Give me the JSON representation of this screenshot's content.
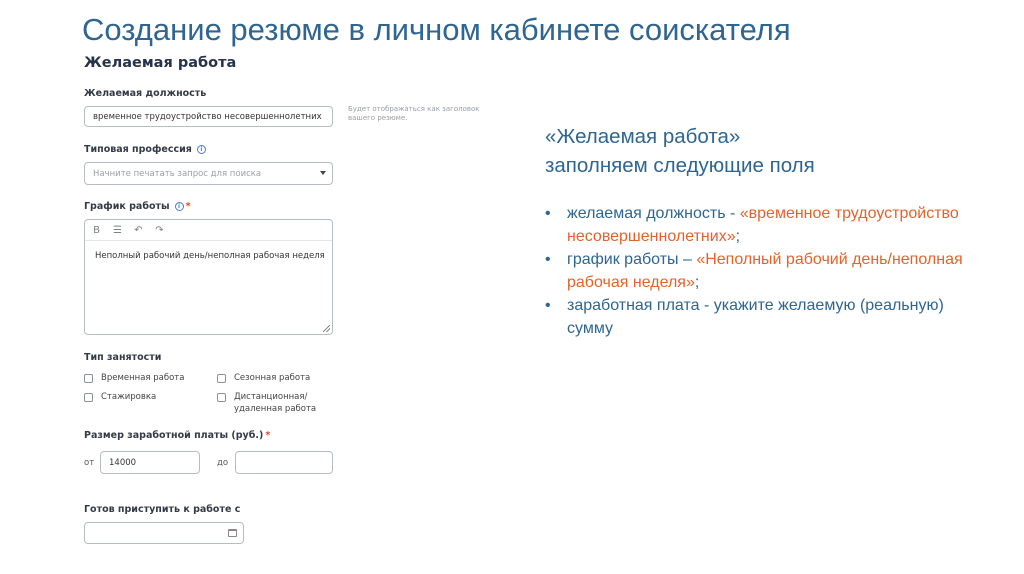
{
  "slide": {
    "title": "Создание резюме в личном кабинете соискателя"
  },
  "form": {
    "section_title": "Желаемая работа",
    "position": {
      "label": "Желаемая должность",
      "value": "временное трудоустройство несовершеннолетних",
      "hint": "Будет отображаться как заголовок вашего резюме."
    },
    "profession": {
      "label": "Типовая профессия",
      "placeholder": "Начните печатать запрос для поиска"
    },
    "schedule": {
      "label": "График работы",
      "required_mark": "*",
      "toolbar": [
        "B",
        "☰",
        "↶",
        "↷"
      ],
      "value": "Неполный рабочий день/неполная рабочая неделя"
    },
    "employment": {
      "label": "Тип занятости",
      "options": [
        "Временная работа",
        "Стажировка",
        "Сезонная работа",
        "Дистанционная/ удаленная работа"
      ]
    },
    "salary": {
      "label": "Размер заработной платы (руб.)",
      "required_mark": "*",
      "from_label": "от",
      "from_value": "14000",
      "to_label": "до",
      "to_value": ""
    },
    "start": {
      "label": "Готов приступить к работе с",
      "value": ""
    }
  },
  "panel": {
    "title_line1": "«Желаемая работа»",
    "title_line2": "заполняем следующие поля",
    "bullets": [
      {
        "prefix": "желаемая должность - ",
        "accent": "«временное трудоустройство несовершеннолетних»",
        "suffix": ";"
      },
      {
        "prefix": "график работы – ",
        "accent": "«Неполный рабочий день/неполная рабочая неделя»",
        "suffix": ";"
      },
      {
        "prefix": "заработная плата - укажите желаемую (реальную) сумму",
        "accent": "",
        "suffix": ""
      }
    ]
  },
  "colors": {
    "title_blue": "#2e6591",
    "accent_orange": "#e0642d",
    "required_red": "#e0482b"
  }
}
